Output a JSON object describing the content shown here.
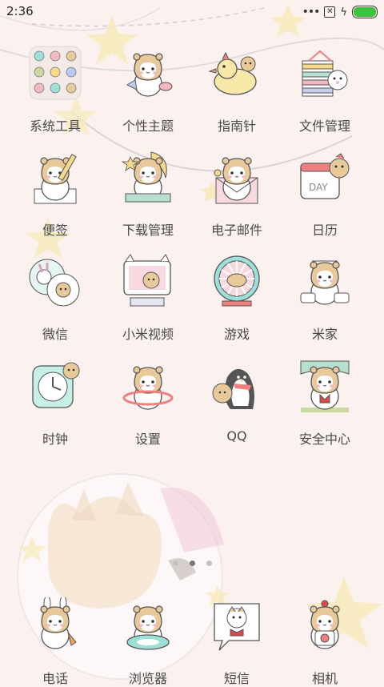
{
  "status": {
    "time": "2:36",
    "battery_level": 1.0,
    "icons": [
      "more-dots-icon",
      "notification-x-icon",
      "charging-bolt-icon",
      "battery-icon"
    ]
  },
  "apps": [
    {
      "label": "系统工具",
      "icon": "folder-icon"
    },
    {
      "label": "个性主题",
      "icon": "hamster-theme-icon"
    },
    {
      "label": "指南针",
      "icon": "duck-compass-icon"
    },
    {
      "label": "文件管理",
      "icon": "file-stack-icon"
    },
    {
      "label": "便签",
      "icon": "pencil-note-icon"
    },
    {
      "label": "下载管理",
      "icon": "moon-download-icon"
    },
    {
      "label": "电子邮件",
      "icon": "envelope-icon"
    },
    {
      "label": "日历",
      "icon": "calendar-icon"
    },
    {
      "label": "微信",
      "icon": "chat-bubble-icon"
    },
    {
      "label": "小米视频",
      "icon": "tv-icon"
    },
    {
      "label": "游戏",
      "icon": "wheel-icon"
    },
    {
      "label": "米家",
      "icon": "hamster-home-icon"
    },
    {
      "label": "时钟",
      "icon": "clock-icon"
    },
    {
      "label": "设置",
      "icon": "hula-hoop-icon"
    },
    {
      "label": "QQ",
      "icon": "penguin-icon"
    },
    {
      "label": "安全中心",
      "icon": "shield-curtain-icon"
    }
  ],
  "pager": {
    "pages": 3,
    "current": 2
  },
  "dock": [
    {
      "label": "电话",
      "icon": "bunny-phone-icon"
    },
    {
      "label": "浏览器",
      "icon": "float-ring-icon"
    },
    {
      "label": "短信",
      "icon": "speech-bubble-icon"
    },
    {
      "label": "相机",
      "icon": "camera-icon"
    }
  ],
  "colors": {
    "background": "#fbf1ef",
    "star": "#f6eab8",
    "hamster_fur": "#e8c99a",
    "accent_pink": "#f4b8c0",
    "accent_teal": "#9ee0d8",
    "battery": "#3cc23c"
  }
}
